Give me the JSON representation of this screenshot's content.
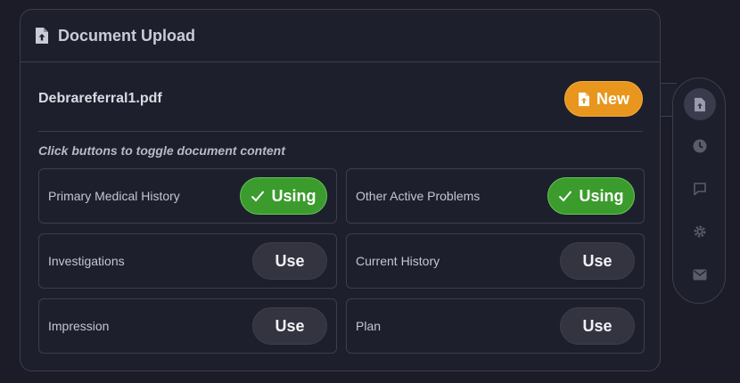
{
  "panel": {
    "title": "Document Upload",
    "title_icon": "file-upload-icon"
  },
  "file": {
    "name": "Debrareferral1.pdf",
    "new_label": "New",
    "new_icon": "file-upload-icon"
  },
  "hint": "Click buttons to toggle document content",
  "sections": [
    {
      "label": "Primary Medical History",
      "button": "Using",
      "state": "using"
    },
    {
      "label": "Other Active Problems",
      "button": "Using",
      "state": "using"
    },
    {
      "label": "Investigations",
      "button": "Use",
      "state": "unused"
    },
    {
      "label": "Current History",
      "button": "Use",
      "state": "unused"
    },
    {
      "label": "Impression",
      "button": "Use",
      "state": "unused"
    },
    {
      "label": "Plan",
      "button": "Use",
      "state": "unused"
    }
  ],
  "side_rail": [
    {
      "icon": "document-upload-icon",
      "active": true
    },
    {
      "icon": "clock-icon",
      "active": false
    },
    {
      "icon": "chat-icon",
      "active": false
    },
    {
      "icon": "gear-icon",
      "active": false
    },
    {
      "icon": "mail-icon",
      "active": false
    }
  ],
  "colors": {
    "accent_orange": "#e8961d",
    "using_green": "#3b9b2d",
    "background": "#1b1c27",
    "panel": "#1e1f2c"
  }
}
